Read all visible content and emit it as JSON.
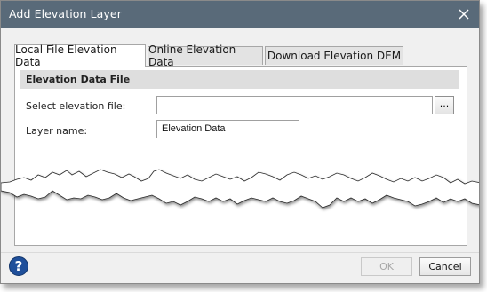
{
  "dialog": {
    "title": "Add Elevation Layer",
    "close_glyph": "✕",
    "close_icon": "close-icon"
  },
  "tabs": [
    {
      "label": "Local File Elevation Data",
      "active": true
    },
    {
      "label": "Online Elevation Data",
      "active": false
    },
    {
      "label": "Download Elevation DEM",
      "active": false
    }
  ],
  "section": {
    "header": "Elevation Data File",
    "select_file_label": "Select elevation file:",
    "select_file_value": "",
    "browse_label": "...",
    "layer_name_label": "Layer name:",
    "layer_name_value": "Elevation Data"
  },
  "footer": {
    "help_glyph": "?",
    "help_icon": "help-icon",
    "ok_label": "OK",
    "ok_enabled": false,
    "cancel_label": "Cancel"
  },
  "colors": {
    "titlebar": "#596a79",
    "dialog_bg": "#f0f0f0",
    "section_header_bg": "#dedede",
    "help_blue": "#1f4f9a"
  }
}
